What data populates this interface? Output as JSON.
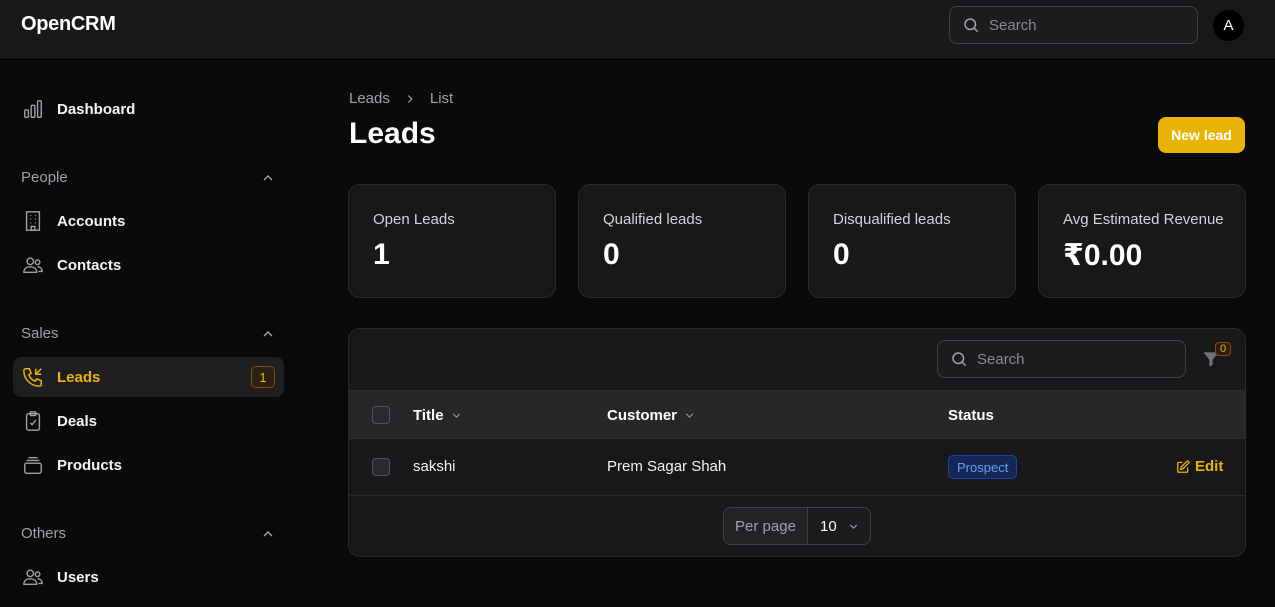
{
  "app": {
    "brand": "OpenCRM",
    "search_placeholder": "Search",
    "avatar_initial": "A"
  },
  "sidebar": {
    "dashboard": "Dashboard",
    "groups": [
      {
        "label": "People",
        "items": [
          "Accounts",
          "Contacts"
        ]
      },
      {
        "label": "Sales",
        "items": [
          "Leads",
          "Deals",
          "Products"
        ]
      },
      {
        "label": "Others",
        "items": [
          "Users"
        ]
      }
    ],
    "leads_badge": "1"
  },
  "main": {
    "breadcrumb": [
      "Leads",
      "List"
    ],
    "title": "Leads",
    "new_button": "New lead",
    "stats": [
      {
        "label": "Open Leads",
        "value": "1"
      },
      {
        "label": "Qualified leads",
        "value": "0"
      },
      {
        "label": "Disqualified leads",
        "value": "0"
      },
      {
        "label": "Avg Estimated Revenue",
        "value": "₹0.00"
      }
    ]
  },
  "table": {
    "search_placeholder": "Search",
    "filter_count": "0",
    "columns": [
      "Title",
      "Customer",
      "Status"
    ],
    "rows": [
      {
        "title": "sakshi",
        "customer": "Prem Sagar Shah",
        "status": "Prospect",
        "action": "Edit"
      }
    ],
    "per_page_label": "Per page",
    "per_page_value": "10"
  },
  "colors": {
    "accent": "#eab308",
    "status_prospect": "#60a5fa",
    "background": "#0a0a0b"
  }
}
